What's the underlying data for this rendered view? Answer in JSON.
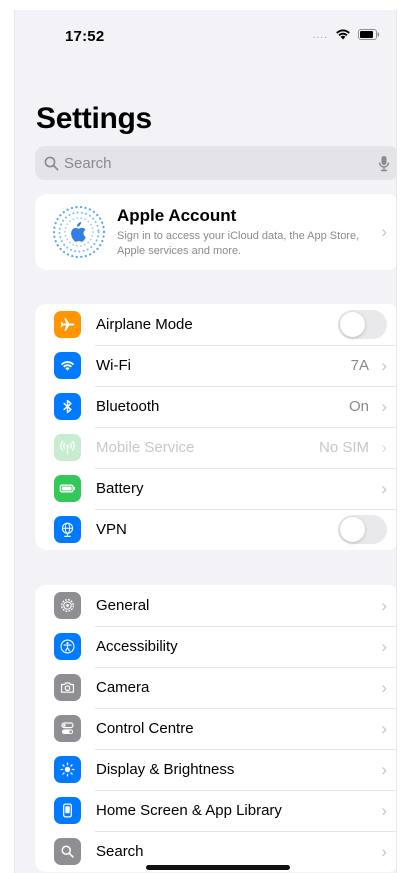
{
  "status_bar": {
    "time": "17:52",
    "signal": "...."
  },
  "title": "Settings",
  "search": {
    "placeholder": "Search"
  },
  "account": {
    "title": "Apple Account",
    "subtitle": "Sign in to access your iCloud data, the App Store, Apple services and more."
  },
  "group1": [
    {
      "label": "Airplane Mode",
      "icon": "airplane-icon",
      "color": "#ff9500",
      "control": "toggle",
      "value": ""
    },
    {
      "label": "Wi-Fi",
      "icon": "wifi-icon",
      "color": "#007aff",
      "control": "chevron",
      "value": "7A"
    },
    {
      "label": "Bluetooth",
      "icon": "bluetooth-icon",
      "color": "#007aff",
      "control": "chevron",
      "value": "On"
    },
    {
      "label": "Mobile Service",
      "icon": "antenna-icon",
      "color": "#34c759",
      "control": "chevron",
      "value": "No SIM"
    },
    {
      "label": "Battery",
      "icon": "battery-icon",
      "color": "#34c759",
      "control": "chevron",
      "value": ""
    },
    {
      "label": "VPN",
      "icon": "globe-icon",
      "color": "#007aff",
      "control": "toggle",
      "value": ""
    }
  ],
  "group2": [
    {
      "label": "General",
      "icon": "gear-icon",
      "color": "#8e8e93"
    },
    {
      "label": "Accessibility",
      "icon": "accessibility-icon",
      "color": "#007aff"
    },
    {
      "label": "Camera",
      "icon": "camera-icon",
      "color": "#8e8e93"
    },
    {
      "label": "Control Centre",
      "icon": "switches-icon",
      "color": "#8e8e93"
    },
    {
      "label": "Display & Brightness",
      "icon": "sun-icon",
      "color": "#007aff"
    },
    {
      "label": "Home Screen & App Library",
      "icon": "phone-icon",
      "color": "#007aff"
    },
    {
      "label": "Search",
      "icon": "search-icon",
      "color": "#8e8e93"
    }
  ]
}
